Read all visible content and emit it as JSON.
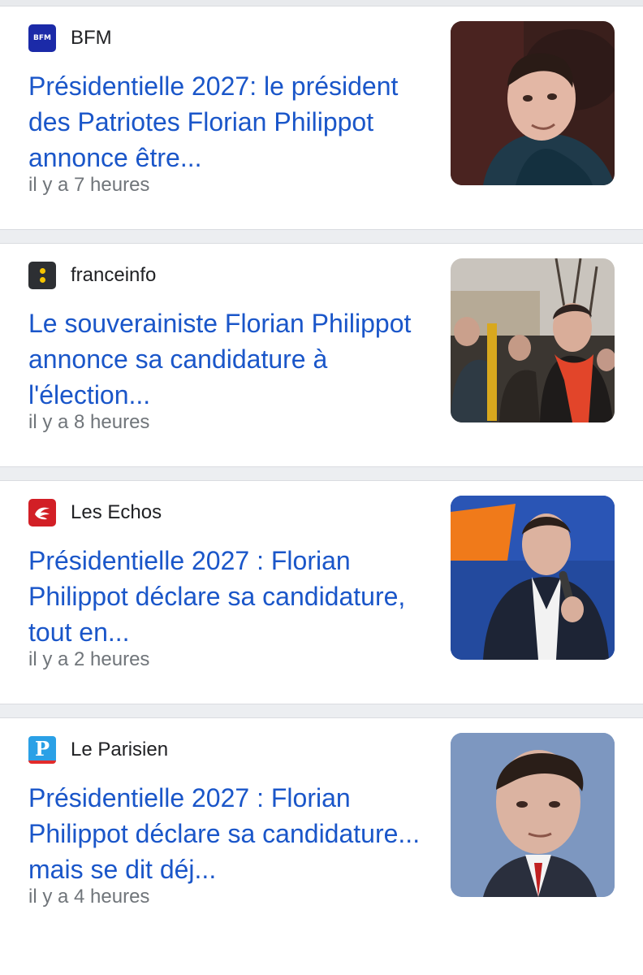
{
  "articles": [
    {
      "source": "BFM",
      "logo_icon": "bfm-logo-icon",
      "headline": "Présidentielle 2027: le président des Patriotes Florian Philippot annonce être...",
      "time": "il y a 7 heures",
      "thumbnail": "portrait-man-dark-coat-photo"
    },
    {
      "source": "franceinfo",
      "logo_icon": "franceinfo-logo-icon",
      "headline": "Le souverainiste Florian Philippot annonce sa candidature à l'élection...",
      "time": "il y a 8 heures",
      "thumbnail": "man-red-scarf-crowd-photo"
    },
    {
      "source": "Les Echos",
      "logo_icon": "les-echos-logo-icon",
      "headline": "Présidentielle 2027 : Florian Philippot déclare sa candidature, tout en...",
      "time": "il y a 2 heures",
      "thumbnail": "man-microphone-speech-photo"
    },
    {
      "source": "Le Parisien",
      "logo_icon": "le-parisien-logo-icon",
      "headline": "Présidentielle 2027 : Florian Philippot déclare sa candidature... mais se dit déj...",
      "time": "il y a 4 heures",
      "thumbnail": "portrait-man-blue-background-photo"
    }
  ],
  "logos": {
    "bfm_text": "BFM",
    "parisien_letter": "P"
  },
  "colors": {
    "headline": "#1a56c9",
    "source": "#202124",
    "time": "#70757a",
    "divider": "#eceef1"
  }
}
